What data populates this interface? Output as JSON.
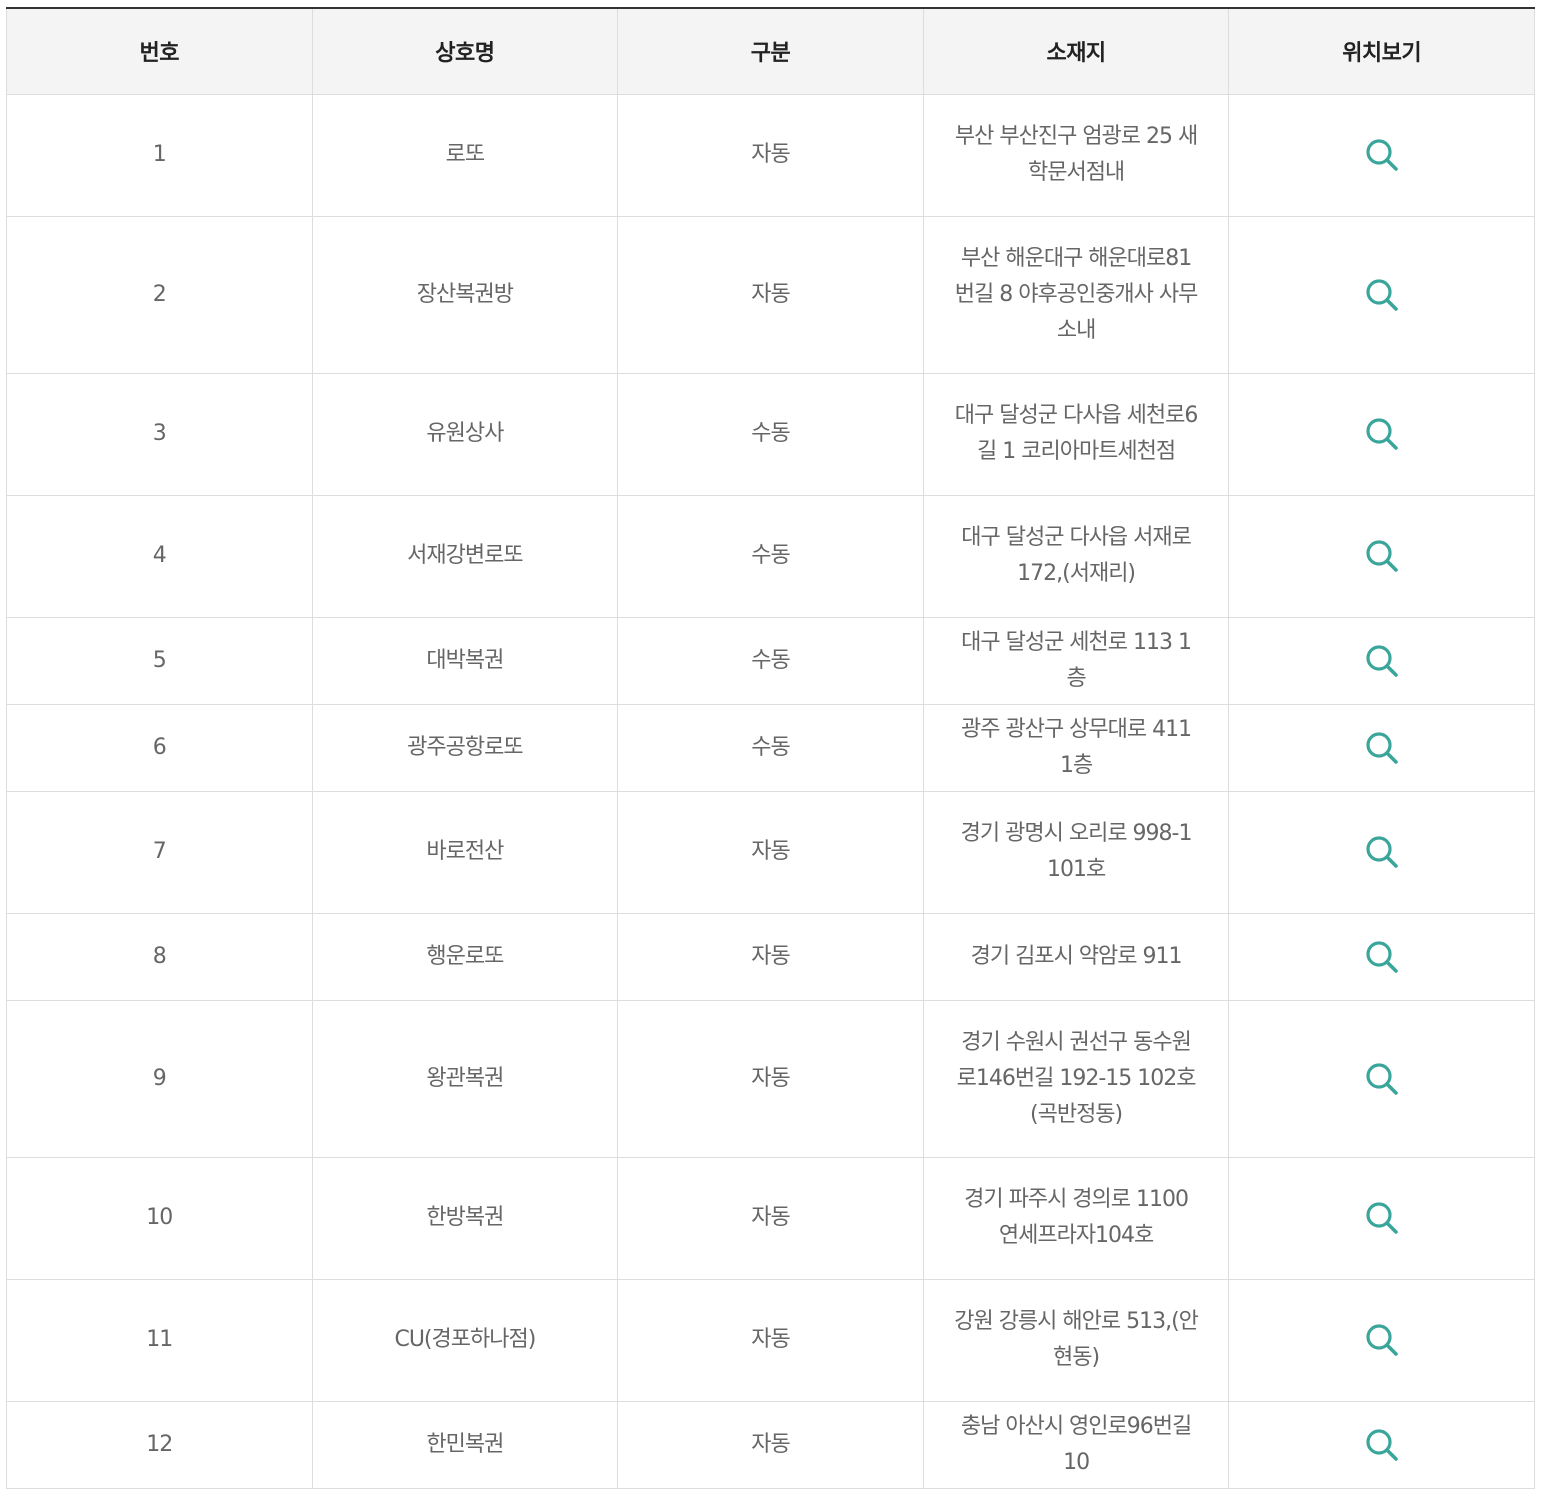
{
  "columns": {
    "number": "번호",
    "name": "상호명",
    "type": "구분",
    "address": "소재지",
    "location": "위치보기"
  },
  "icon": {
    "name": "magnifier-icon",
    "color": "#3aa69b"
  },
  "rows": [
    {
      "number": "1",
      "name": "로또",
      "type": "자동",
      "address": "부산 부산진구 엄광로 25 새학문서점내"
    },
    {
      "number": "2",
      "name": "장산복권방",
      "type": "자동",
      "address": "부산 해운대구 해운대로81번길 8 야후공인중개사 사무소내"
    },
    {
      "number": "3",
      "name": "유원상사",
      "type": "수동",
      "address": "대구 달성군 다사읍 세천로6길 1 코리아마트세천점"
    },
    {
      "number": "4",
      "name": "서재강변로또",
      "type": "수동",
      "address": "대구 달성군 다사읍 서재로 172,(서재리)"
    },
    {
      "number": "5",
      "name": "대박복권",
      "type": "수동",
      "address": "대구 달성군 세천로 113 1층"
    },
    {
      "number": "6",
      "name": "광주공항로또",
      "type": "수동",
      "address": "광주 광산구 상무대로 411 1층"
    },
    {
      "number": "7",
      "name": "바로전산",
      "type": "자동",
      "address": "경기 광명시 오리로 998-1 101호"
    },
    {
      "number": "8",
      "name": "행운로또",
      "type": "자동",
      "address": "경기 김포시 약암로 911"
    },
    {
      "number": "9",
      "name": "왕관복권",
      "type": "자동",
      "address": "경기 수원시 권선구 동수원로146번길 192-15 102호(곡반정동)"
    },
    {
      "number": "10",
      "name": "한방복권",
      "type": "자동",
      "address": "경기 파주시 경의로 1100 연세프라자104호"
    },
    {
      "number": "11",
      "name": "CU(경포하나점)",
      "type": "자동",
      "address": "강원 강릉시 해안로 513,(안현동)"
    },
    {
      "number": "12",
      "name": "한민복권",
      "type": "자동",
      "address": "충남 아산시 영인로96번길 10"
    }
  ]
}
